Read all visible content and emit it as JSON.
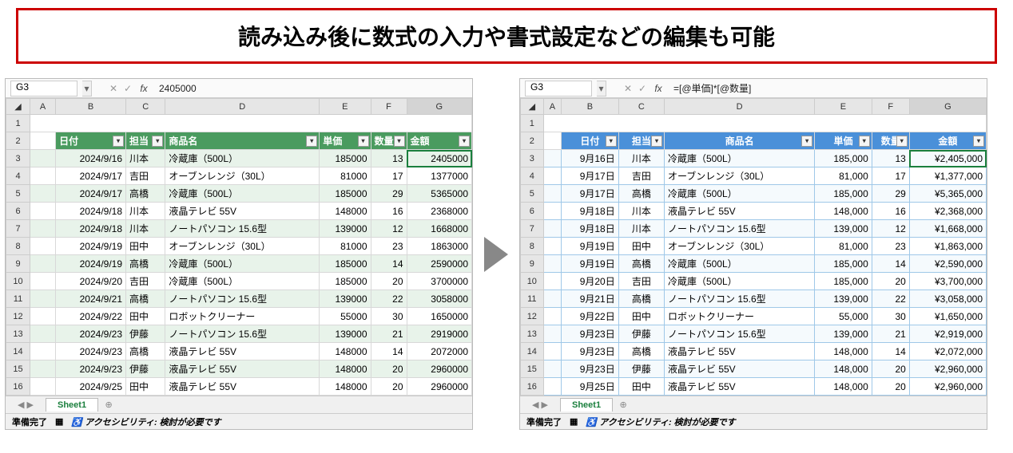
{
  "banner": "読み込み後に数式の入力や書式設定などの編集も可能",
  "left": {
    "name_cell": "G3",
    "formula": "2405000",
    "cols": [
      "A",
      "B",
      "C",
      "D",
      "E",
      "F",
      "G"
    ],
    "headers": {
      "date": "日付",
      "tantou": "担当",
      "product": "商品名",
      "unit": "単価",
      "qty": "数量",
      "amount": "金額"
    },
    "rows": [
      {
        "r": "3",
        "date": "2024/9/16",
        "t": "川本",
        "p": "冷蔵庫（500L）",
        "u": "185000",
        "q": "13",
        "a": "2405000"
      },
      {
        "r": "4",
        "date": "2024/9/17",
        "t": "吉田",
        "p": "オーブンレンジ（30L）",
        "u": "81000",
        "q": "17",
        "a": "1377000"
      },
      {
        "r": "5",
        "date": "2024/9/17",
        "t": "高橋",
        "p": "冷蔵庫（500L）",
        "u": "185000",
        "q": "29",
        "a": "5365000"
      },
      {
        "r": "6",
        "date": "2024/9/18",
        "t": "川本",
        "p": "液晶テレビ 55V",
        "u": "148000",
        "q": "16",
        "a": "2368000"
      },
      {
        "r": "7",
        "date": "2024/9/18",
        "t": "川本",
        "p": "ノートパソコン 15.6型",
        "u": "139000",
        "q": "12",
        "a": "1668000"
      },
      {
        "r": "8",
        "date": "2024/9/19",
        "t": "田中",
        "p": "オーブンレンジ（30L）",
        "u": "81000",
        "q": "23",
        "a": "1863000"
      },
      {
        "r": "9",
        "date": "2024/9/19",
        "t": "高橋",
        "p": "冷蔵庫（500L）",
        "u": "185000",
        "q": "14",
        "a": "2590000"
      },
      {
        "r": "10",
        "date": "2024/9/20",
        "t": "吉田",
        "p": "冷蔵庫（500L）",
        "u": "185000",
        "q": "20",
        "a": "3700000"
      },
      {
        "r": "11",
        "date": "2024/9/21",
        "t": "高橋",
        "p": "ノートパソコン 15.6型",
        "u": "139000",
        "q": "22",
        "a": "3058000"
      },
      {
        "r": "12",
        "date": "2024/9/22",
        "t": "田中",
        "p": "ロボットクリーナー",
        "u": "55000",
        "q": "30",
        "a": "1650000"
      },
      {
        "r": "13",
        "date": "2024/9/23",
        "t": "伊藤",
        "p": "ノートパソコン 15.6型",
        "u": "139000",
        "q": "21",
        "a": "2919000"
      },
      {
        "r": "14",
        "date": "2024/9/23",
        "t": "高橋",
        "p": "液晶テレビ 55V",
        "u": "148000",
        "q": "14",
        "a": "2072000"
      },
      {
        "r": "15",
        "date": "2024/9/23",
        "t": "伊藤",
        "p": "液晶テレビ 55V",
        "u": "148000",
        "q": "20",
        "a": "2960000"
      },
      {
        "r": "16",
        "date": "2024/9/25",
        "t": "田中",
        "p": "液晶テレビ 55V",
        "u": "148000",
        "q": "20",
        "a": "2960000"
      }
    ],
    "sheet_tab": "Sheet1",
    "status_ready": "準備完了",
    "status_acc": "アクセシビリティ: 検討が必要です"
  },
  "right": {
    "name_cell": "G3",
    "formula": "=[@単価]*[@数量]",
    "cols": [
      "A",
      "B",
      "C",
      "D",
      "E",
      "F",
      "G"
    ],
    "headers": {
      "date": "日付",
      "tantou": "担当",
      "product": "商品名",
      "unit": "単価",
      "qty": "数量",
      "amount": "金額"
    },
    "rows": [
      {
        "r": "3",
        "date": "9月16日",
        "t": "川本",
        "p": "冷蔵庫（500L）",
        "u": "185,000",
        "q": "13",
        "a": "¥2,405,000"
      },
      {
        "r": "4",
        "date": "9月17日",
        "t": "吉田",
        "p": "オーブンレンジ（30L）",
        "u": "81,000",
        "q": "17",
        "a": "¥1,377,000"
      },
      {
        "r": "5",
        "date": "9月17日",
        "t": "高橋",
        "p": "冷蔵庫（500L）",
        "u": "185,000",
        "q": "29",
        "a": "¥5,365,000"
      },
      {
        "r": "6",
        "date": "9月18日",
        "t": "川本",
        "p": "液晶テレビ 55V",
        "u": "148,000",
        "q": "16",
        "a": "¥2,368,000"
      },
      {
        "r": "7",
        "date": "9月18日",
        "t": "川本",
        "p": "ノートパソコン 15.6型",
        "u": "139,000",
        "q": "12",
        "a": "¥1,668,000"
      },
      {
        "r": "8",
        "date": "9月19日",
        "t": "田中",
        "p": "オーブンレンジ（30L）",
        "u": "81,000",
        "q": "23",
        "a": "¥1,863,000"
      },
      {
        "r": "9",
        "date": "9月19日",
        "t": "高橋",
        "p": "冷蔵庫（500L）",
        "u": "185,000",
        "q": "14",
        "a": "¥2,590,000"
      },
      {
        "r": "10",
        "date": "9月20日",
        "t": "吉田",
        "p": "冷蔵庫（500L）",
        "u": "185,000",
        "q": "20",
        "a": "¥3,700,000"
      },
      {
        "r": "11",
        "date": "9月21日",
        "t": "高橋",
        "p": "ノートパソコン 15.6型",
        "u": "139,000",
        "q": "22",
        "a": "¥3,058,000"
      },
      {
        "r": "12",
        "date": "9月22日",
        "t": "田中",
        "p": "ロボットクリーナー",
        "u": "55,000",
        "q": "30",
        "a": "¥1,650,000"
      },
      {
        "r": "13",
        "date": "9月23日",
        "t": "伊藤",
        "p": "ノートパソコン 15.6型",
        "u": "139,000",
        "q": "21",
        "a": "¥2,919,000"
      },
      {
        "r": "14",
        "date": "9月23日",
        "t": "高橋",
        "p": "液晶テレビ 55V",
        "u": "148,000",
        "q": "14",
        "a": "¥2,072,000"
      },
      {
        "r": "15",
        "date": "9月23日",
        "t": "伊藤",
        "p": "液晶テレビ 55V",
        "u": "148,000",
        "q": "20",
        "a": "¥2,960,000"
      },
      {
        "r": "16",
        "date": "9月25日",
        "t": "田中",
        "p": "液晶テレビ 55V",
        "u": "148,000",
        "q": "20",
        "a": "¥2,960,000"
      }
    ],
    "sheet_tab": "Sheet1",
    "status_ready": "準備完了",
    "status_acc": "アクセシビリティ: 検討が必要です"
  }
}
